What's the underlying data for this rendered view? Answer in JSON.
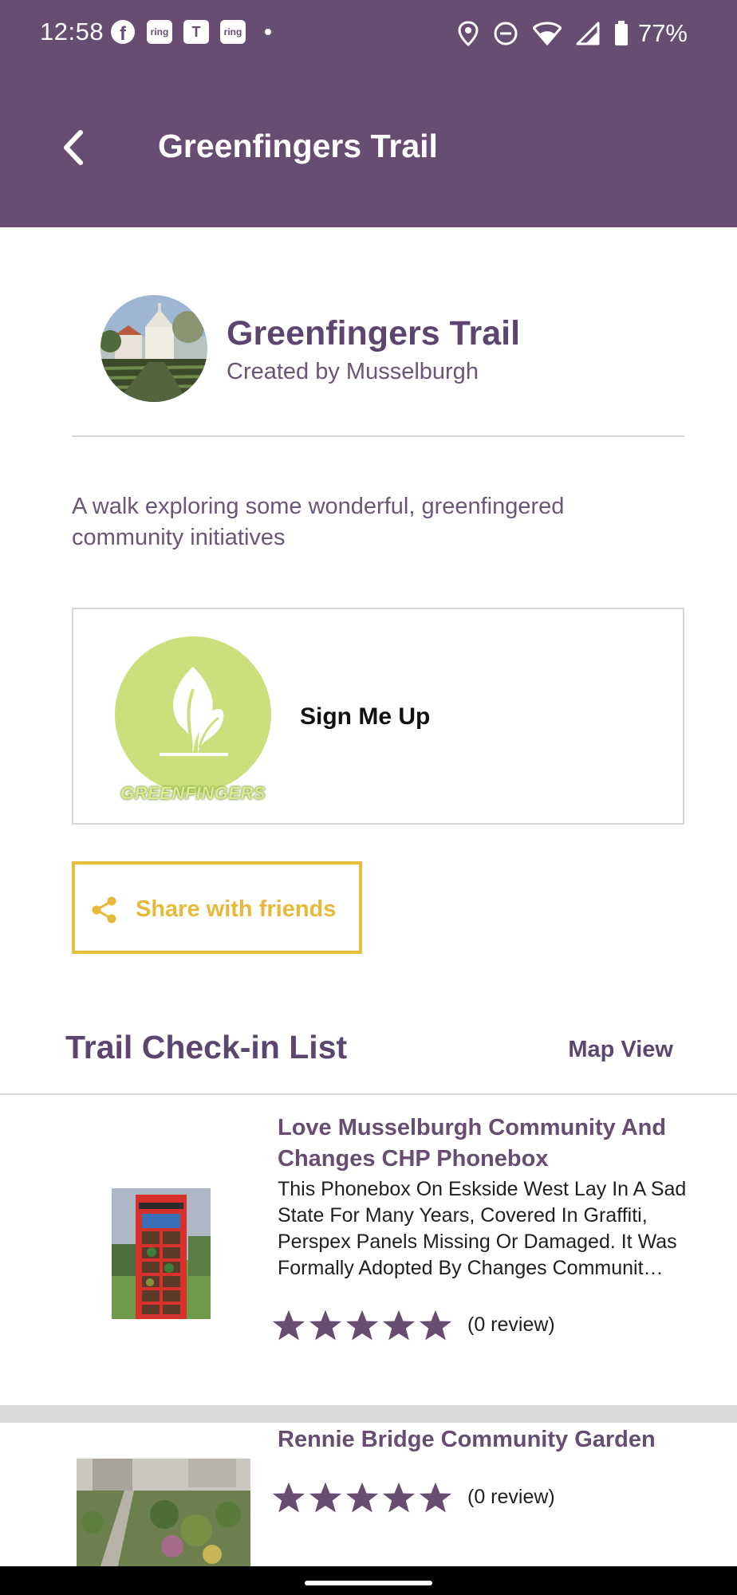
{
  "status_bar": {
    "time": "12:58",
    "left_icons": [
      "facebook-icon",
      "ring-icon",
      "teams-icon",
      "ring-icon",
      "dot-icon"
    ],
    "ring_label": "ring",
    "teams_label": "T",
    "right_icons": [
      "location-icon",
      "do-not-disturb-icon",
      "wifi-icon",
      "signal-icon",
      "battery-icon"
    ],
    "battery": "77%"
  },
  "app_bar": {
    "title": "Greenfingers Trail",
    "back_icon": "chevron-left-icon"
  },
  "trail": {
    "name": "Greenfingers Trail",
    "creator": "Created by Musselburgh",
    "description": "A walk exploring some wonderful, greenfingered community initiatives"
  },
  "signup_card": {
    "logo_text": "GREENFINGERS",
    "label": "Sign Me Up"
  },
  "share": {
    "label": "Share with friends",
    "icon": "share-icon"
  },
  "checkin": {
    "title": "Trail Check-in List",
    "map_view": "Map View",
    "items": [
      {
        "title": "Love Musselburgh Community And Changes CHP Phonebox",
        "description": "This Phonebox On Eskside West Lay In A Sad State For Many Years, Covered In Graffiti, Perspex Panels Missing Or Damaged. It Was Formally Adopted By Changes Communit…",
        "rating": 0,
        "reviews": "(0 review)"
      },
      {
        "title": "Rennie Bridge Community Garden",
        "rating": 0,
        "reviews": "(0 review)"
      }
    ]
  },
  "colors": {
    "brand_purple": "#674d72",
    "accent_gold": "#e6bd3c",
    "logo_green": "#cbe07c"
  }
}
